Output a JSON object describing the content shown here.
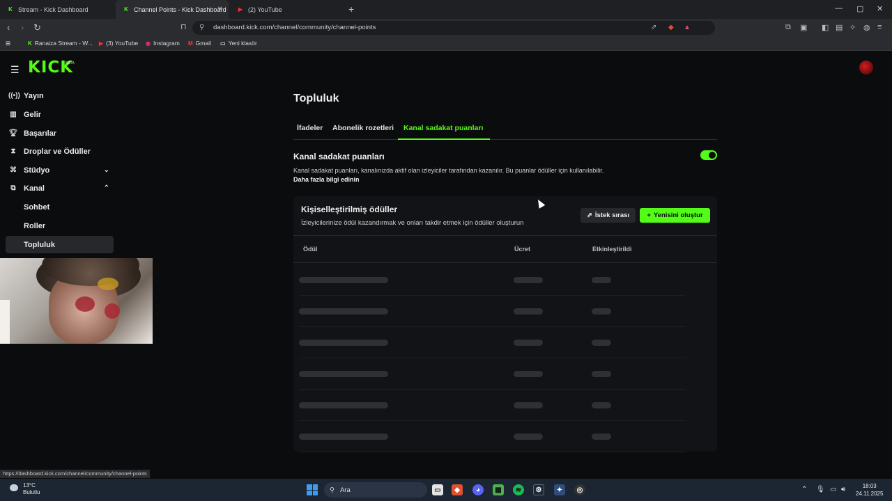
{
  "browser": {
    "tabs": [
      {
        "title": "Stream - Kick Dashboard",
        "icon": "kick-icon"
      },
      {
        "title": "Channel Points - Kick Dashboard",
        "icon": "kick-icon"
      },
      {
        "title": "(2) YouTube",
        "icon": "youtube-icon"
      }
    ],
    "url": "dashboard.kick.com/channel/community/channel-points",
    "bookmarks": [
      {
        "label": "Ranaiza Stream - W...",
        "icon": "kick-icon"
      },
      {
        "label": "(3) YouTube",
        "icon": "youtube-icon"
      },
      {
        "label": "Instagram",
        "icon": "instagram-icon"
      },
      {
        "label": "Gmail",
        "icon": "gmail-icon"
      },
      {
        "label": "Yeni klasör",
        "icon": "folder-icon"
      }
    ],
    "status_url": "https://dashboard.kick.com/channel/community/channel-points"
  },
  "app": {
    "logo": "KICK",
    "logo_badge": "BETA",
    "accent": "#53fc18",
    "sidebar": [
      {
        "label": "Yayın",
        "icon": "broadcast-icon"
      },
      {
        "label": "Gelir",
        "icon": "revenue-icon"
      },
      {
        "label": "Başarılar",
        "icon": "trophy-icon"
      },
      {
        "label": "Droplar ve Ödüller",
        "icon": "gift-icon"
      },
      {
        "label": "Stüdyo",
        "icon": "studio-icon"
      },
      {
        "label": "Kanal",
        "icon": "channel-icon"
      },
      {
        "label": "Sohbet"
      },
      {
        "label": "Roller"
      },
      {
        "label": "Topluluk"
      }
    ]
  },
  "main": {
    "title": "Topluluk",
    "tabs": [
      "İfadeler",
      "Abonelik rozetleri",
      "Kanal sadakat puanları"
    ],
    "section": {
      "title": "Kanal sadakat puanları",
      "description": "Kanal sadakat puanları, kanalınızda aktif olan izleyiciler tarafından kazanılır. Bu puanlar ödüller için kullanılabilir.",
      "link": "Daha fazla bilgi edinin",
      "enabled": true
    },
    "rewards": {
      "title": "Kişiselleştirilmiş ödüller",
      "description": "İzleyicilerinize ödül kazandırmak ve onları takdir etmek için ödüller oluşturun",
      "queue_button": "İstek sırası",
      "create_button": "Yenisini oluştur",
      "columns": [
        "Ödül",
        "Ücret",
        "Etkinleştirildi"
      ],
      "loading_rows": 6
    }
  },
  "taskbar": {
    "weather_temp": "13°C",
    "weather_desc": "Bulutlu",
    "search": "Ara",
    "time": "18:03",
    "date": "24.11.2025"
  }
}
